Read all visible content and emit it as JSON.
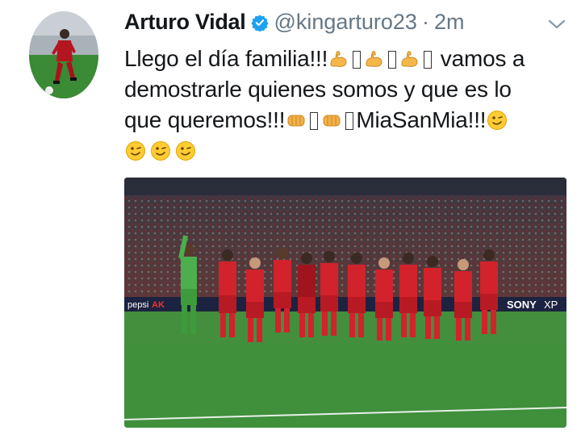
{
  "tweet": {
    "author_name": "Arturo Vidal",
    "handle": "@kingarturo23",
    "separator": "·",
    "time": "2m",
    "line1_text": "Llego el día familia!!!",
    "part_vamos": " vamos a",
    "line2_text": "demostrarle quienes somos y que es lo",
    "line3_text": "que queremos!!!",
    "hashtag_text": "MiaSanMia!!!",
    "emoji": {
      "flexed_biceps": "flexed-biceps",
      "fist": "oncoming-fist",
      "wink": "winking-face"
    }
  },
  "photo": {
    "subject": "team-celebration-photo",
    "ad_boards": [
      "pepsi",
      "AK",
      "SONY",
      "XP"
    ]
  },
  "colors": {
    "name": "#14171a",
    "meta": "#657786",
    "verified": "#1da1f2",
    "kit_red": "#d2222c",
    "pitch": "#3f8f3b"
  }
}
